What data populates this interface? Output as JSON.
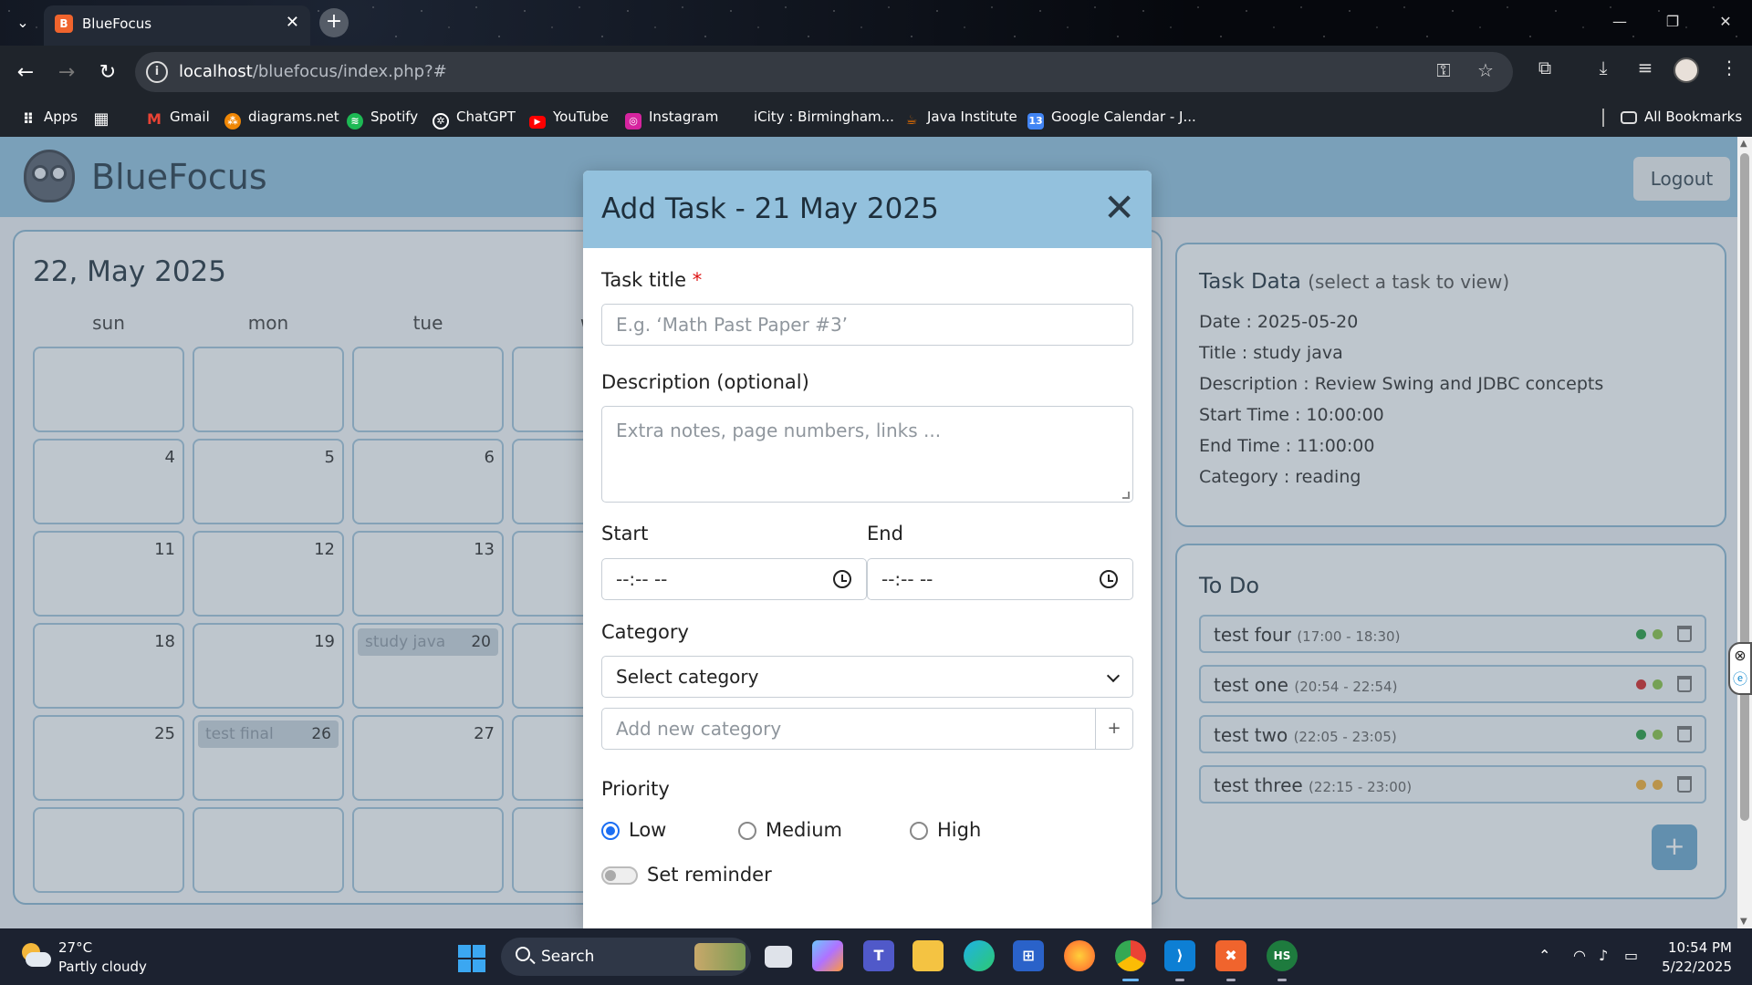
{
  "browser": {
    "tab_title": "BlueFocus",
    "tab_favicon": "B",
    "url_host": "localhost",
    "url_path": "/bluefocus/index.php?#",
    "bookmarks": [
      {
        "label": "Apps",
        "icon": "apps-grid-icon",
        "color": "#ffffff"
      },
      {
        "label": "Gmail",
        "icon": "gmail-icon",
        "color": "#ea4335"
      },
      {
        "label": "diagrams.net",
        "icon": "diagrams-icon",
        "color": "#f08705"
      },
      {
        "label": "Spotify",
        "icon": "spotify-icon",
        "color": "#1db954"
      },
      {
        "label": "ChatGPT",
        "icon": "chatgpt-icon",
        "color": "#ffffff"
      },
      {
        "label": "YouTube",
        "icon": "youtube-icon",
        "color": "#ff0000"
      },
      {
        "label": "Instagram",
        "icon": "instagram-icon",
        "color": "#d6249f"
      },
      {
        "label": "iCity : Birmingham...",
        "icon": "",
        "color": ""
      },
      {
        "label": "Java Institute",
        "icon": "java-icon",
        "color": "#e76f00"
      },
      {
        "label": "Google Calendar - J...",
        "icon": "calendar-icon",
        "color": "#4285f4"
      }
    ],
    "all_bookmarks": "All Bookmarks"
  },
  "app": {
    "brand": "BlueFocus",
    "logout": "Logout"
  },
  "calendar": {
    "title": "22, May 2025",
    "day_headers": [
      "sun",
      "mon",
      "tue",
      "w"
    ],
    "rows": [
      [
        {
          "n": ""
        },
        {
          "n": ""
        },
        {
          "n": ""
        },
        {
          "n": ""
        }
      ],
      [
        {
          "n": "4"
        },
        {
          "n": "5"
        },
        {
          "n": "6"
        },
        {
          "n": ""
        }
      ],
      [
        {
          "n": "11"
        },
        {
          "n": "12"
        },
        {
          "n": "13"
        },
        {
          "n": ""
        }
      ],
      [
        {
          "n": "18"
        },
        {
          "n": "19"
        },
        {
          "n": "20",
          "event": "study java"
        },
        {
          "n": ""
        }
      ],
      [
        {
          "n": "25"
        },
        {
          "n": "26",
          "event": "test final"
        },
        {
          "n": "27"
        },
        {
          "n": ""
        }
      ],
      [
        {
          "n": ""
        },
        {
          "n": ""
        },
        {
          "n": ""
        },
        {
          "n": ""
        }
      ]
    ]
  },
  "task_data": {
    "title": "Task Data",
    "subtitle": "(select a task to view)",
    "date": "Date : 2025-05-20",
    "task_title": "Title : study java",
    "description": "Description : Review Swing and JDBC concepts",
    "start_time": "Start Time : 10:00:00",
    "end_time": "End Time : 11:00:00",
    "category": "Category : reading"
  },
  "todo": {
    "title": "To Do",
    "items": [
      {
        "name": "test four",
        "time": "(17:00 - 18:30)",
        "dot1": "#2e9e47",
        "dot2": "#8bc34a"
      },
      {
        "name": "test one",
        "time": "(20:54 - 22:54)",
        "dot1": "#d32f2f",
        "dot2": "#8bc34a"
      },
      {
        "name": "test two",
        "time": "(22:05 - 23:05)",
        "dot1": "#2e9e47",
        "dot2": "#8bc34a"
      },
      {
        "name": "test three",
        "time": "(22:15 - 23:00)",
        "dot1": "#f0b03c",
        "dot2": "#f0b03c"
      }
    ],
    "add_label": "+"
  },
  "modal": {
    "title": "Add Task - 21 May 2025",
    "close": "✕",
    "task_title_label": "Task title",
    "required_mark": "*",
    "task_title_placeholder": "E.g. ‘Math Past Paper #3’",
    "description_label": "Description (optional)",
    "description_placeholder": "Extra notes, page numbers, links ...",
    "start_label": "Start",
    "end_label": "End",
    "start_value": "--:-- --",
    "end_value": "--:-- --",
    "category_label": "Category",
    "category_selected": "Select category",
    "new_category_placeholder": "Add new category",
    "add_category_button": "+",
    "priority_label": "Priority",
    "priorities": [
      "Low",
      "Medium",
      "High"
    ],
    "priority_selected": "Low",
    "reminder_label": "Set reminder",
    "reminder_on": false
  },
  "taskbar": {
    "temperature": "27°C",
    "weather": "Partly cloudy",
    "search_label": "Search",
    "time": "10:54 PM",
    "date": "5/22/2025"
  }
}
